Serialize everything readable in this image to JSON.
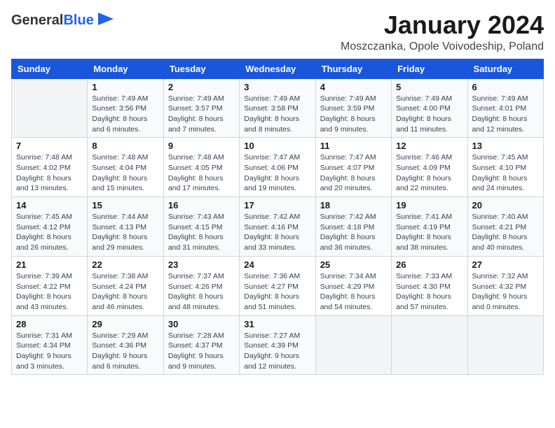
{
  "header": {
    "logo_general": "General",
    "logo_blue": "Blue",
    "title": "January 2024",
    "subtitle": "Moszczanka, Opole Voivodeship, Poland"
  },
  "calendar": {
    "days_of_week": [
      "Sunday",
      "Monday",
      "Tuesday",
      "Wednesday",
      "Thursday",
      "Friday",
      "Saturday"
    ],
    "weeks": [
      [
        {
          "date": "",
          "sunrise": "",
          "sunset": "",
          "daylight": ""
        },
        {
          "date": "1",
          "sunrise": "Sunrise: 7:49 AM",
          "sunset": "Sunset: 3:56 PM",
          "daylight": "Daylight: 8 hours and 6 minutes."
        },
        {
          "date": "2",
          "sunrise": "Sunrise: 7:49 AM",
          "sunset": "Sunset: 3:57 PM",
          "daylight": "Daylight: 8 hours and 7 minutes."
        },
        {
          "date": "3",
          "sunrise": "Sunrise: 7:49 AM",
          "sunset": "Sunset: 3:58 PM",
          "daylight": "Daylight: 8 hours and 8 minutes."
        },
        {
          "date": "4",
          "sunrise": "Sunrise: 7:49 AM",
          "sunset": "Sunset: 3:59 PM",
          "daylight": "Daylight: 8 hours and 9 minutes."
        },
        {
          "date": "5",
          "sunrise": "Sunrise: 7:49 AM",
          "sunset": "Sunset: 4:00 PM",
          "daylight": "Daylight: 8 hours and 11 minutes."
        },
        {
          "date": "6",
          "sunrise": "Sunrise: 7:49 AM",
          "sunset": "Sunset: 4:01 PM",
          "daylight": "Daylight: 8 hours and 12 minutes."
        }
      ],
      [
        {
          "date": "7",
          "sunrise": "Sunrise: 7:48 AM",
          "sunset": "Sunset: 4:02 PM",
          "daylight": "Daylight: 8 hours and 13 minutes."
        },
        {
          "date": "8",
          "sunrise": "Sunrise: 7:48 AM",
          "sunset": "Sunset: 4:04 PM",
          "daylight": "Daylight: 8 hours and 15 minutes."
        },
        {
          "date": "9",
          "sunrise": "Sunrise: 7:48 AM",
          "sunset": "Sunset: 4:05 PM",
          "daylight": "Daylight: 8 hours and 17 minutes."
        },
        {
          "date": "10",
          "sunrise": "Sunrise: 7:47 AM",
          "sunset": "Sunset: 4:06 PM",
          "daylight": "Daylight: 8 hours and 19 minutes."
        },
        {
          "date": "11",
          "sunrise": "Sunrise: 7:47 AM",
          "sunset": "Sunset: 4:07 PM",
          "daylight": "Daylight: 8 hours and 20 minutes."
        },
        {
          "date": "12",
          "sunrise": "Sunrise: 7:46 AM",
          "sunset": "Sunset: 4:09 PM",
          "daylight": "Daylight: 8 hours and 22 minutes."
        },
        {
          "date": "13",
          "sunrise": "Sunrise: 7:45 AM",
          "sunset": "Sunset: 4:10 PM",
          "daylight": "Daylight: 8 hours and 24 minutes."
        }
      ],
      [
        {
          "date": "14",
          "sunrise": "Sunrise: 7:45 AM",
          "sunset": "Sunset: 4:12 PM",
          "daylight": "Daylight: 8 hours and 26 minutes."
        },
        {
          "date": "15",
          "sunrise": "Sunrise: 7:44 AM",
          "sunset": "Sunset: 4:13 PM",
          "daylight": "Daylight: 8 hours and 29 minutes."
        },
        {
          "date": "16",
          "sunrise": "Sunrise: 7:43 AM",
          "sunset": "Sunset: 4:15 PM",
          "daylight": "Daylight: 8 hours and 31 minutes."
        },
        {
          "date": "17",
          "sunrise": "Sunrise: 7:42 AM",
          "sunset": "Sunset: 4:16 PM",
          "daylight": "Daylight: 8 hours and 33 minutes."
        },
        {
          "date": "18",
          "sunrise": "Sunrise: 7:42 AM",
          "sunset": "Sunset: 4:18 PM",
          "daylight": "Daylight: 8 hours and 36 minutes."
        },
        {
          "date": "19",
          "sunrise": "Sunrise: 7:41 AM",
          "sunset": "Sunset: 4:19 PM",
          "daylight": "Daylight: 8 hours and 38 minutes."
        },
        {
          "date": "20",
          "sunrise": "Sunrise: 7:40 AM",
          "sunset": "Sunset: 4:21 PM",
          "daylight": "Daylight: 8 hours and 40 minutes."
        }
      ],
      [
        {
          "date": "21",
          "sunrise": "Sunrise: 7:39 AM",
          "sunset": "Sunset: 4:22 PM",
          "daylight": "Daylight: 8 hours and 43 minutes."
        },
        {
          "date": "22",
          "sunrise": "Sunrise: 7:38 AM",
          "sunset": "Sunset: 4:24 PM",
          "daylight": "Daylight: 8 hours and 46 minutes."
        },
        {
          "date": "23",
          "sunrise": "Sunrise: 7:37 AM",
          "sunset": "Sunset: 4:26 PM",
          "daylight": "Daylight: 8 hours and 48 minutes."
        },
        {
          "date": "24",
          "sunrise": "Sunrise: 7:36 AM",
          "sunset": "Sunset: 4:27 PM",
          "daylight": "Daylight: 8 hours and 51 minutes."
        },
        {
          "date": "25",
          "sunrise": "Sunrise: 7:34 AM",
          "sunset": "Sunset: 4:29 PM",
          "daylight": "Daylight: 8 hours and 54 minutes."
        },
        {
          "date": "26",
          "sunrise": "Sunrise: 7:33 AM",
          "sunset": "Sunset: 4:30 PM",
          "daylight": "Daylight: 8 hours and 57 minutes."
        },
        {
          "date": "27",
          "sunrise": "Sunrise: 7:32 AM",
          "sunset": "Sunset: 4:32 PM",
          "daylight": "Daylight: 9 hours and 0 minutes."
        }
      ],
      [
        {
          "date": "28",
          "sunrise": "Sunrise: 7:31 AM",
          "sunset": "Sunset: 4:34 PM",
          "daylight": "Daylight: 9 hours and 3 minutes."
        },
        {
          "date": "29",
          "sunrise": "Sunrise: 7:29 AM",
          "sunset": "Sunset: 4:36 PM",
          "daylight": "Daylight: 9 hours and 6 minutes."
        },
        {
          "date": "30",
          "sunrise": "Sunrise: 7:28 AM",
          "sunset": "Sunset: 4:37 PM",
          "daylight": "Daylight: 9 hours and 9 minutes."
        },
        {
          "date": "31",
          "sunrise": "Sunrise: 7:27 AM",
          "sunset": "Sunset: 4:39 PM",
          "daylight": "Daylight: 9 hours and 12 minutes."
        },
        {
          "date": "",
          "sunrise": "",
          "sunset": "",
          "daylight": ""
        },
        {
          "date": "",
          "sunrise": "",
          "sunset": "",
          "daylight": ""
        },
        {
          "date": "",
          "sunrise": "",
          "sunset": "",
          "daylight": ""
        }
      ]
    ]
  }
}
